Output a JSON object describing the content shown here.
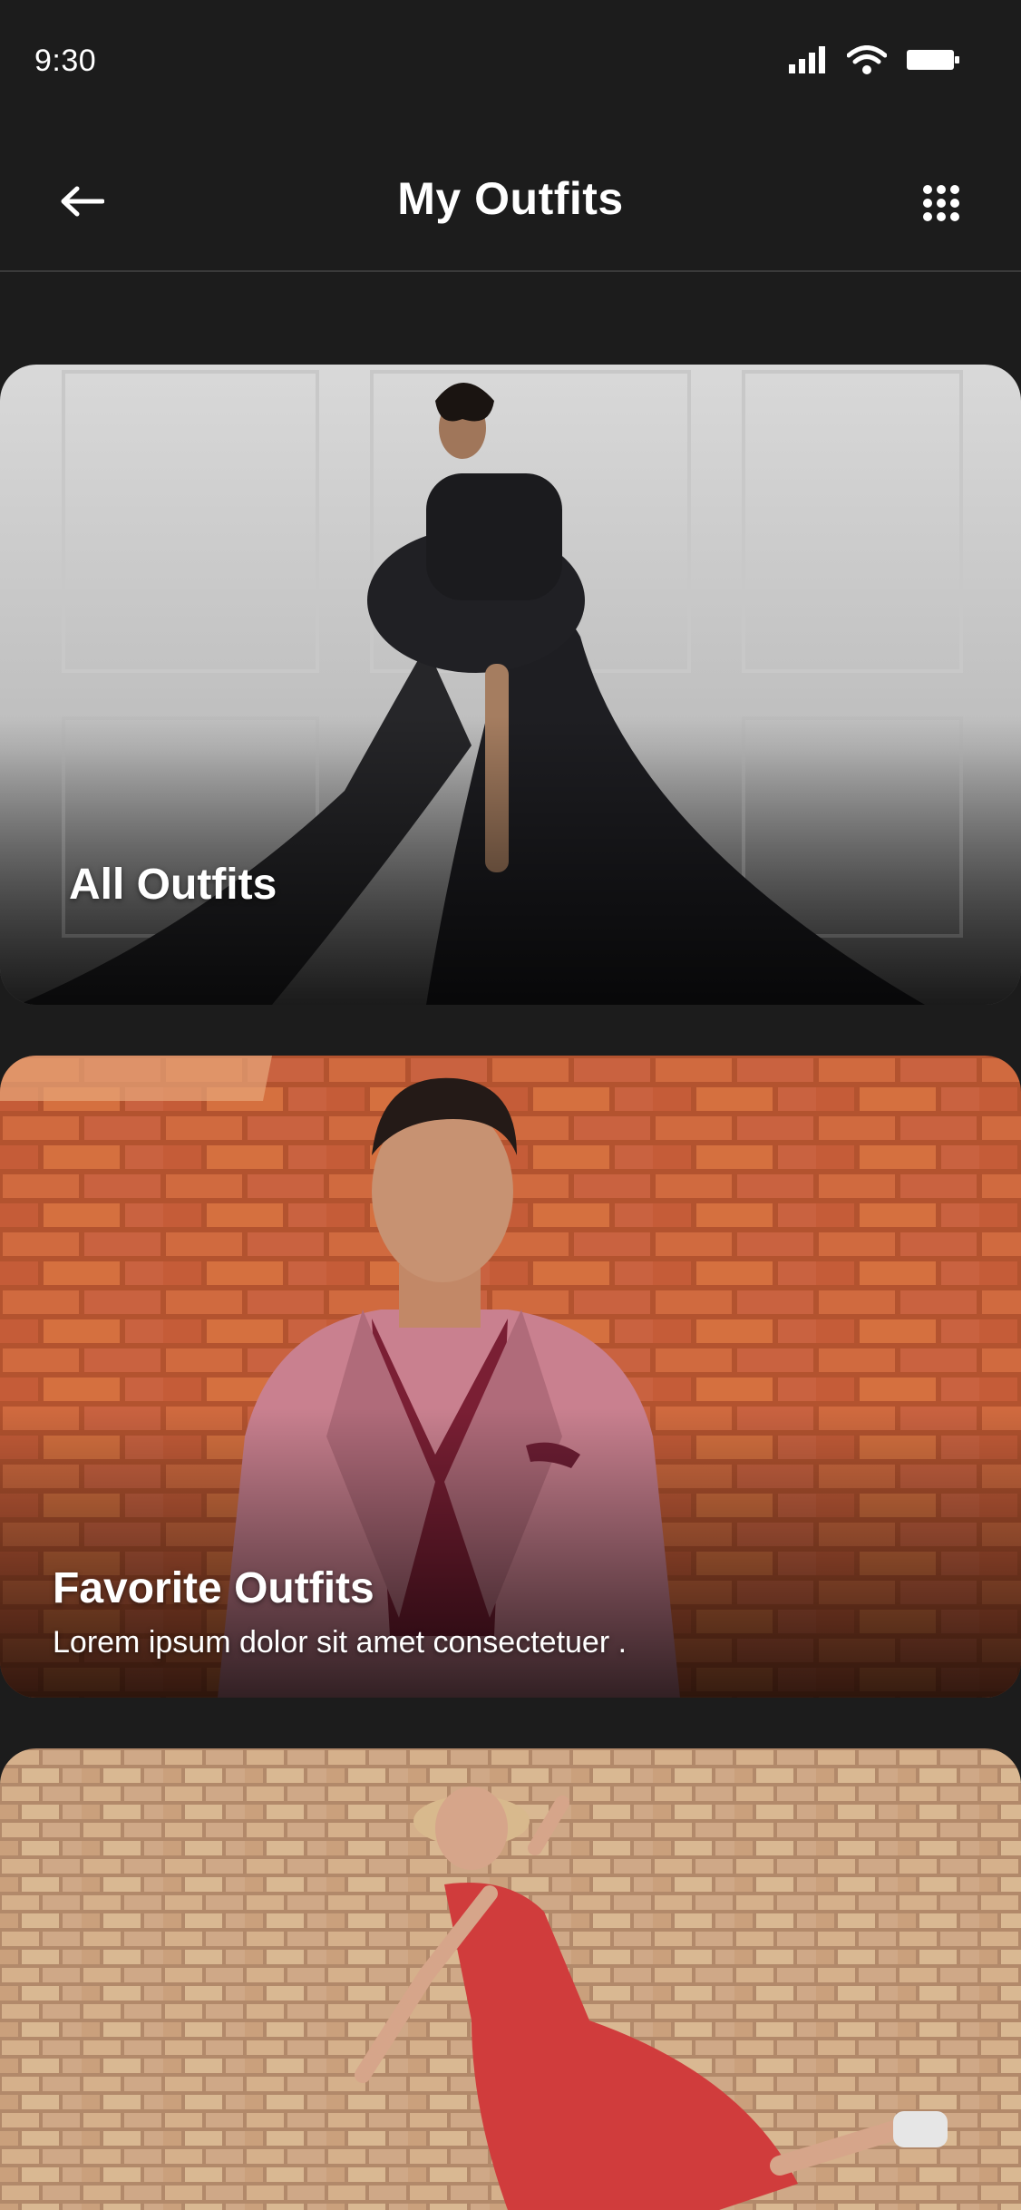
{
  "status_bar": {
    "time": "9:30"
  },
  "header": {
    "title": "My Outfits"
  },
  "cards": [
    {
      "title": "All Outfits",
      "subtitle": ""
    },
    {
      "title": "Favorite Outfits",
      "subtitle": "Lorem ipsum dolor sit amet consectetuer ."
    },
    {
      "title": "",
      "subtitle": ""
    }
  ],
  "colors": {
    "background": "#1c1c1c",
    "text": "#ffffff"
  },
  "icons": {
    "back": "arrow-left-icon",
    "menu": "grid-dots-icon"
  }
}
